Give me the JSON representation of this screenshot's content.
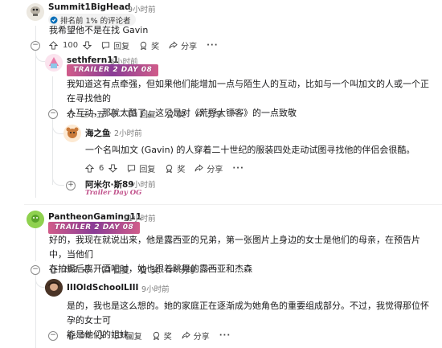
{
  "comments": [
    {
      "username": "Summit1BigHead",
      "time": "· 9小时前",
      "rank_badge": "排名前 1% 的评论者",
      "body": "我希望他不是在找 Gavin",
      "score": "100",
      "actions": {
        "reply": "回复",
        "award": "奖",
        "share": "分享",
        "more": "···"
      }
    },
    {
      "username": "sethfern11",
      "time": "· 5小时前",
      "flair": "TRAILER 2 DAY 08",
      "body_line1": "我知道这有点牵强，但如果他们能增加一点与陌生人的互动，比如与一个叫加文的人或一个正在寻找他的",
      "body_line2": "人互动，那就太酷了，这只是对《荒野大镖客》的一点致敬",
      "score": "三十五",
      "actions": {
        "reply": "回复",
        "award": "奖",
        "share": "分享",
        "more": "···"
      }
    },
    {
      "username": "海之鱼",
      "time": "· 2小时前",
      "body": "一个名叫加文 (Gavin) 的人穿着二十世纪的服装四处走动试图寻找他的伴侣会很酷。",
      "score": "6",
      "actions": {
        "reply": "回复",
        "award": "奖",
        "share": "分享",
        "more": "···"
      }
    },
    {
      "username": "阿米尔·斯89",
      "time": "· 3小时前",
      "flair": "Trailer Day OG"
    },
    {
      "username": "PantheonGaming11",
      "time": "· 11小时前",
      "flair": "TRAILER 2 DAY 08",
      "body_line1": "好的，我现在就说出来，他是露西亚的兄弟，第一张图片上身边的女士是他们的母亲，在预告片中，当他们",
      "body_line2": "在拍摄后离开酒吧时，她也跟着跳舞的露西亚和杰森",
      "score": "282",
      "actions": {
        "reply": "回复",
        "award": "奖",
        "share": "分享",
        "more": "···"
      }
    },
    {
      "username": "IIIOldSchoolLIII",
      "time": "· 9小时前",
      "body_line1": "是的，我也是这么想的。她的家庭正在逐渐成为她角色的重要组成部分。不过，我觉得那位怀孕的女士可",
      "body_line2": "能是他们的姐妹。",
      "score": "56",
      "actions": {
        "reply": "回复",
        "award": "奖",
        "share": "分享",
        "more": "···"
      }
    }
  ],
  "colors": {
    "flair_pink": "#c0508a",
    "thread_line": "#e5e7e9",
    "meta_gray": "#7c7c7c"
  },
  "icons": [
    "upvote-icon",
    "downvote-icon",
    "reply-icon",
    "award-icon",
    "share-icon",
    "collapse-icon",
    "expand-icon"
  ]
}
